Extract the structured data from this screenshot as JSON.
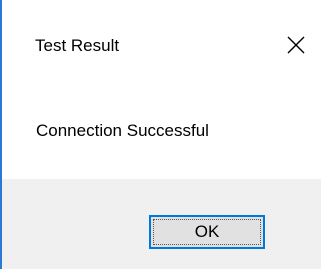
{
  "window": {
    "title": "Test Result",
    "close_icon": "close-icon"
  },
  "content": {
    "message": "Connection Successful"
  },
  "footer": {
    "ok_label": "OK"
  },
  "colors": {
    "accent": "#0078d7",
    "window_border": "#2b79d6",
    "footer_bg": "#f0f0f0",
    "button_bg": "#e1e1e1"
  }
}
